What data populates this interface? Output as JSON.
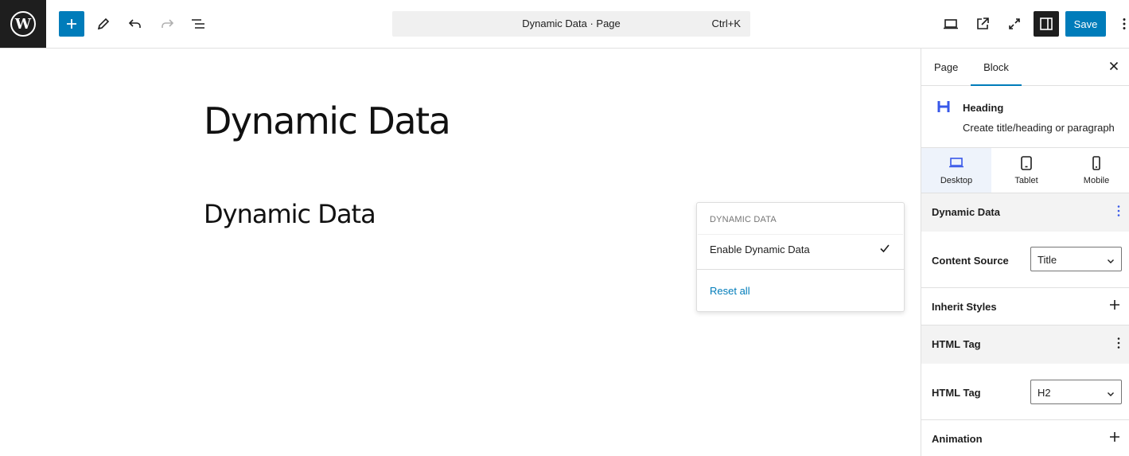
{
  "toolbar": {
    "logo_icon": "wordpress-logo",
    "add_icon": "plus-icon",
    "tools_icon": "pencil-icon",
    "undo_icon": "undo-icon",
    "redo_icon": "redo-icon",
    "outline_icon": "list-view-icon",
    "command_title": "Dynamic Data · Page",
    "command_shortcut": "Ctrl+K",
    "view_icon": "laptop-icon",
    "preview_icon": "external-link-icon",
    "fullscreen_icon": "fullscreen-icon",
    "settings_icon": "sidebar-icon",
    "save_label": "Save",
    "more_icon": "vertical-ellipsis-icon",
    "accent_color": "#007cba"
  },
  "canvas": {
    "post_title": "Dynamic Data",
    "heading_text": "Dynamic Data"
  },
  "popover": {
    "heading": "DYNAMIC DATA",
    "item_label": "Enable Dynamic Data",
    "item_checked": true,
    "reset_label": "Reset all"
  },
  "sidebar": {
    "tabs": [
      {
        "label": "Page",
        "active": false
      },
      {
        "label": "Block",
        "active": true
      }
    ],
    "block": {
      "name": "Heading",
      "description": "Create title/heading or paragraph"
    },
    "devices": [
      {
        "label": "Desktop",
        "icon": "desktop-icon",
        "active": true
      },
      {
        "label": "Tablet",
        "icon": "tablet-icon",
        "active": false
      },
      {
        "label": "Mobile",
        "icon": "mobile-icon",
        "active": false
      }
    ],
    "panels": {
      "dynamic_data": {
        "title": "Dynamic Data"
      },
      "content_source": {
        "label": "Content Source",
        "value": "Title"
      },
      "inherit_styles": {
        "title": "Inherit Styles"
      },
      "html_tag_panel": {
        "title": "HTML Tag"
      },
      "html_tag": {
        "label": "HTML Tag",
        "value": "H2"
      },
      "animation": {
        "title": "Animation"
      }
    }
  }
}
